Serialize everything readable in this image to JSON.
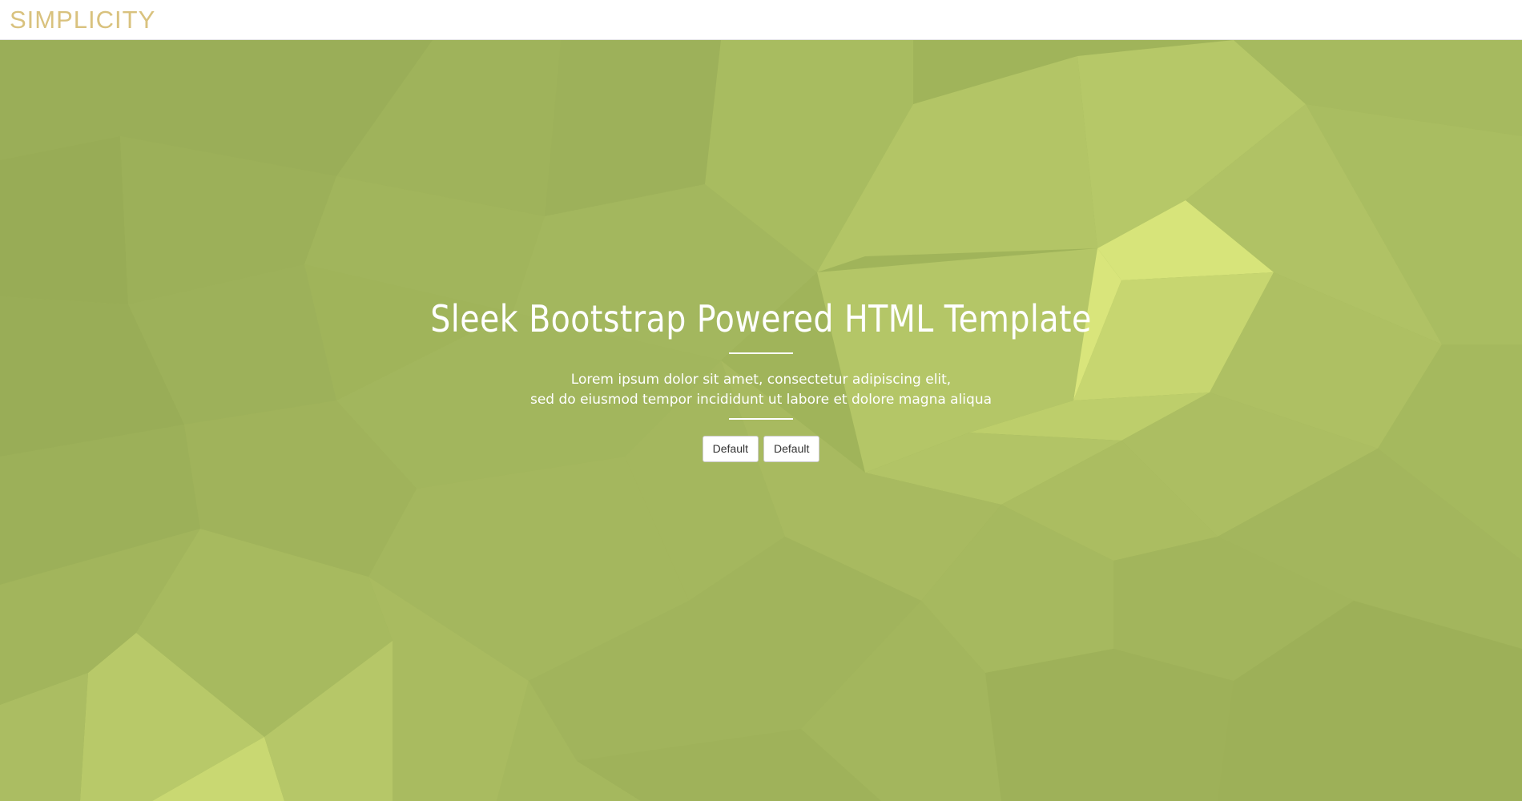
{
  "navbar": {
    "brand": "SIMPLICITY"
  },
  "hero": {
    "title": "Sleek Bootstrap Powered HTML Template",
    "subtitle_line1": "Lorem ipsum dolor sit amet, consectetur adipiscing elit,",
    "subtitle_line2": "sed do eiusmod tempor incididunt ut labore et dolore magna aliqua",
    "buttons": [
      {
        "label": "Default"
      },
      {
        "label": "Default"
      }
    ]
  },
  "colors": {
    "brand": "#d9c27e",
    "hero_background": "#a0b45a",
    "accent_light": "#dbe87a"
  }
}
